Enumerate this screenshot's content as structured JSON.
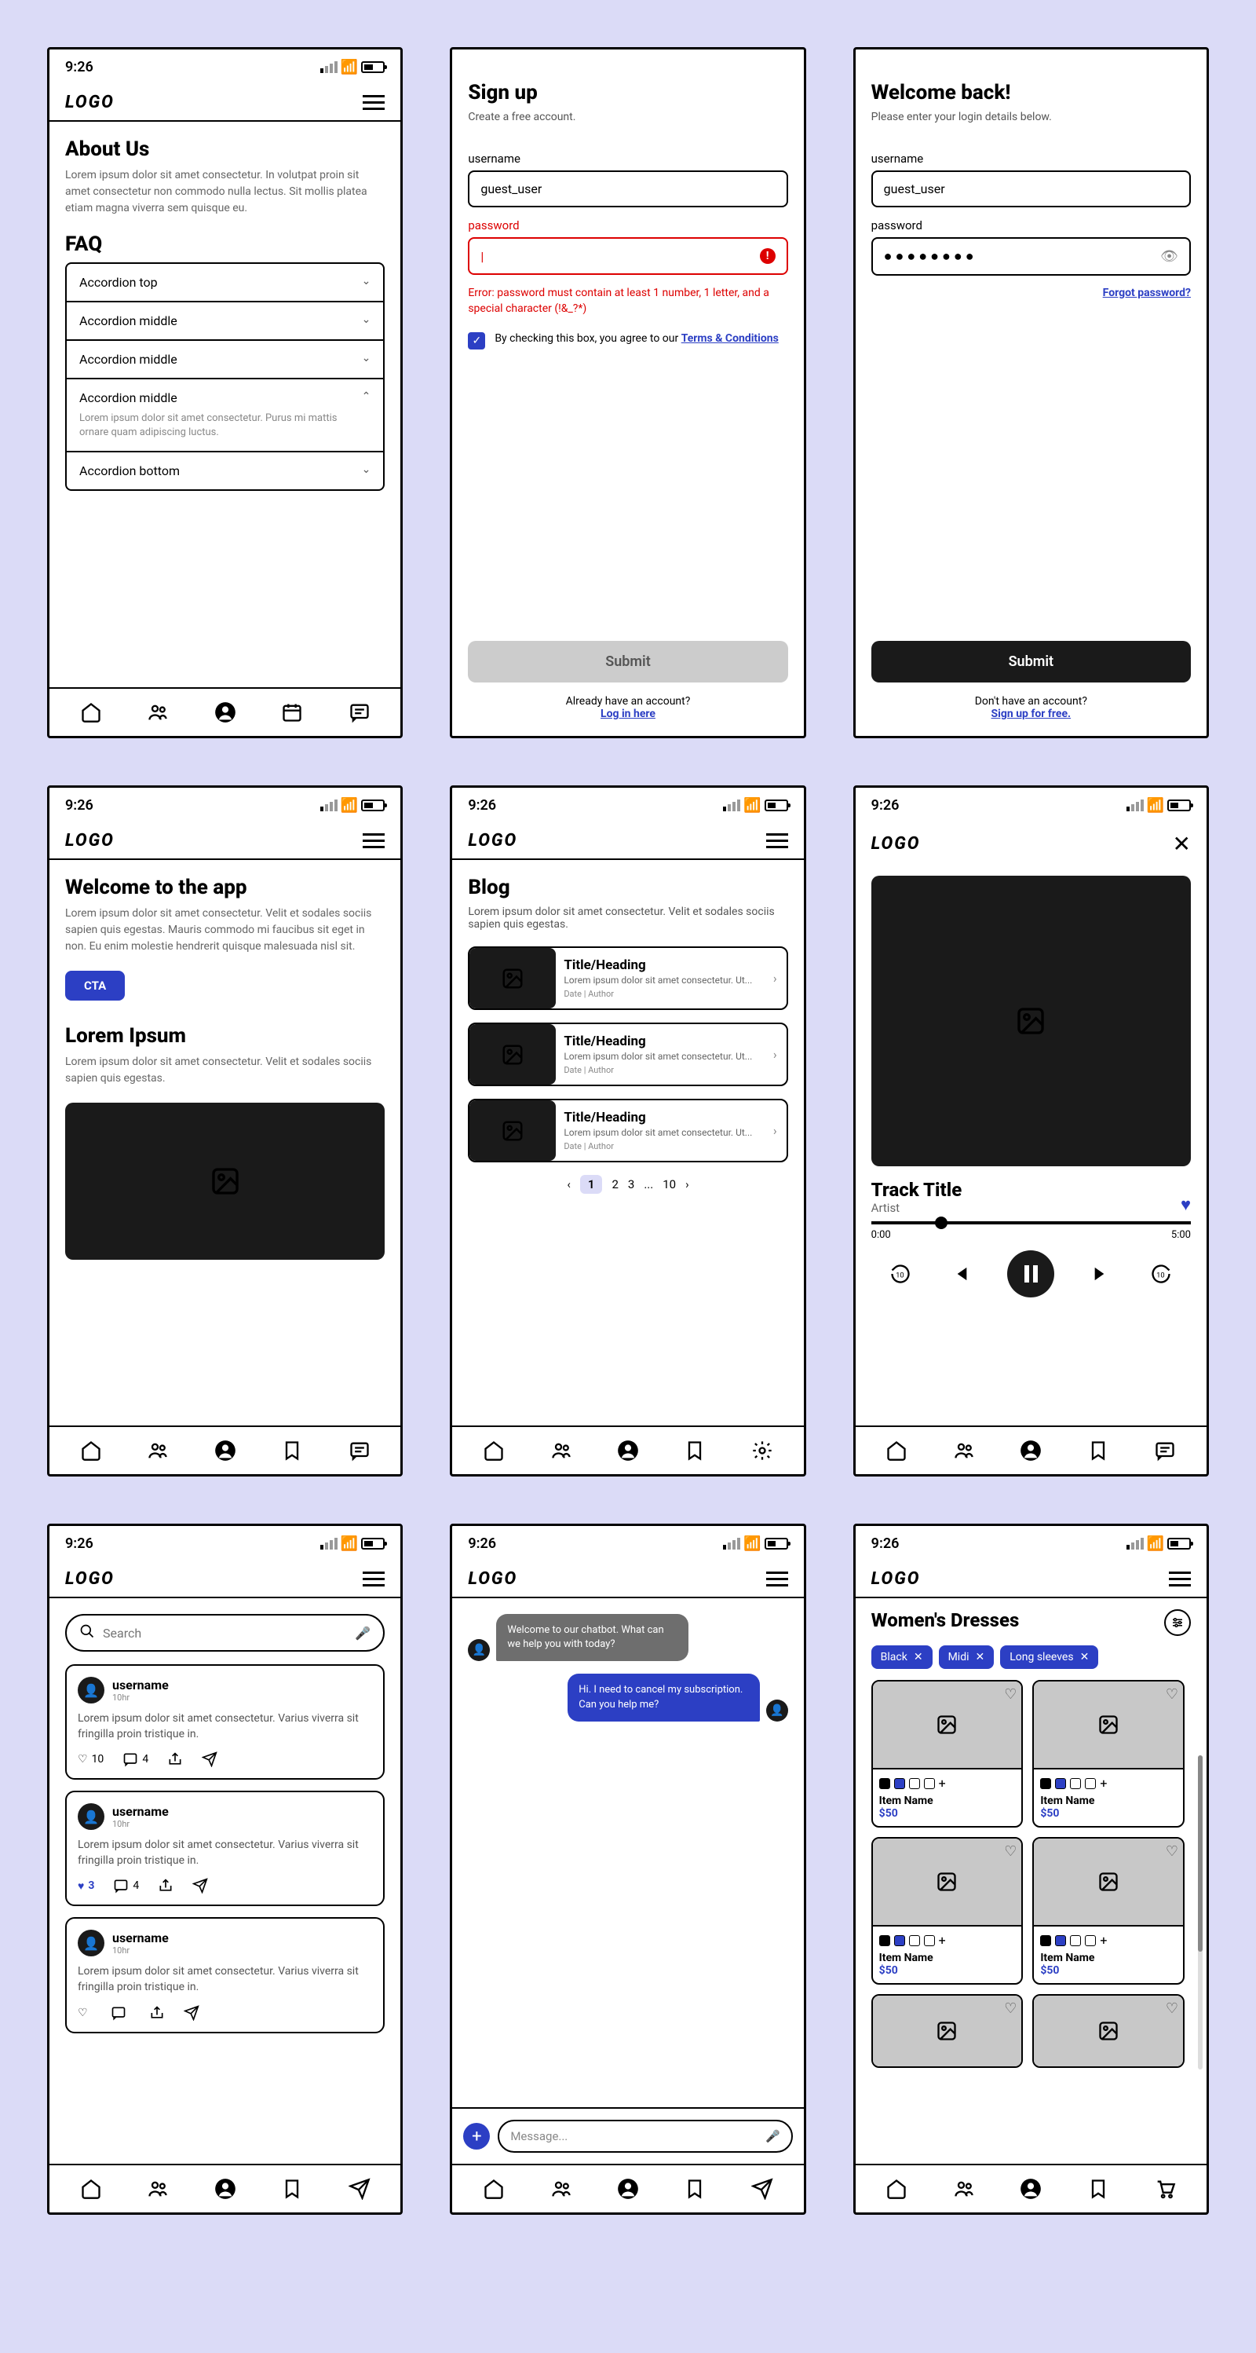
{
  "common": {
    "time": "9:26",
    "logo": "LOGO"
  },
  "s1": {
    "title": "About Us",
    "body": "Lorem ipsum dolor sit amet consectetur. In volutpat proin sit amet consectetur non commodo nulla lectus. Sit mollis platea etiam magna viverra sem quisque eu.",
    "faq": "FAQ",
    "acc": [
      "Accordion top",
      "Accordion middle",
      "Accordion middle",
      "Accordion middle",
      "Accordion bottom"
    ],
    "acc_body": "Lorem ipsum dolor sit amet consectetur. Purus mi mattis ornare quam adipiscing luctus."
  },
  "s2": {
    "title": "Sign up",
    "sub": "Create a free account.",
    "u_lbl": "username",
    "u_val": "guest_user",
    "p_lbl": "password",
    "err": "Error: password must contain at least 1 number, 1 letter, and a special character (!&_?*)",
    "chk": "By checking this box, you agree to our ",
    "chk_link": "Terms & Conditions",
    "submit": "Submit",
    "foot": "Already have an account?",
    "foot_link": "Log in here"
  },
  "s3": {
    "title": "Welcome back!",
    "sub": "Please enter your login details below.",
    "u_lbl": "username",
    "u_val": "guest_user",
    "p_lbl": "password",
    "forgot": "Forgot password?",
    "submit": "Submit",
    "foot": "Don't have an account?",
    "foot_link": "Sign up for free."
  },
  "s4": {
    "title": "Welcome to the app",
    "body": "Lorem ipsum dolor sit amet consectetur. Velit et sodales sociis sapien quis egestas. Mauris commodo mi faucibus sit eget in non. Eu enim molestie hendrerit quisque malesuada nisl sit.",
    "cta": "CTA",
    "h2": "Lorem Ipsum",
    "body2": "Lorem ipsum dolor sit amet consectetur. Velit et sodales sociis sapien quis egestas."
  },
  "s5": {
    "title": "Blog",
    "sub": "Lorem ipsum dolor sit amet consectetur. Velit et sodales sociis sapien quis egestas.",
    "card_t": "Title/Heading",
    "card_b": "Lorem ipsum dolor sit amet consectetur. Ut...",
    "meta": "Date | Author",
    "pages": [
      "1",
      "2",
      "3",
      "...",
      "10"
    ]
  },
  "s6": {
    "title": "Track Title",
    "artist": "Artist",
    "t0": "0:00",
    "t1": "5:00"
  },
  "s7": {
    "search": "Search",
    "posts": [
      {
        "u": "username",
        "t": "10hr",
        "b": "Lorem ipsum dolor sit amet consectetur. Varius viverra sit fringilla proin tristique in.",
        "likes": "10",
        "c": "4",
        "liked": false
      },
      {
        "u": "username",
        "t": "10hr",
        "b": "Lorem ipsum dolor sit amet consectetur. Varius viverra sit fringilla proin tristique in.",
        "likes": "3",
        "c": "4",
        "liked": true
      },
      {
        "u": "username",
        "t": "10hr",
        "b": "Lorem ipsum dolor sit amet consectetur. Varius viverra sit fringilla proin tristique in.",
        "likes": "",
        "c": "",
        "liked": false
      }
    ]
  },
  "s8": {
    "bot": "Welcome to our chatbot. What can we help you with today?",
    "user": "Hi. I need to cancel my subscription. Can you help me?",
    "placeholder": "Message..."
  },
  "s9": {
    "title": "Women's Dresses",
    "chips": [
      "Black",
      "Midi",
      "Long sleeves"
    ],
    "name": "Item Name",
    "price": "$50"
  }
}
